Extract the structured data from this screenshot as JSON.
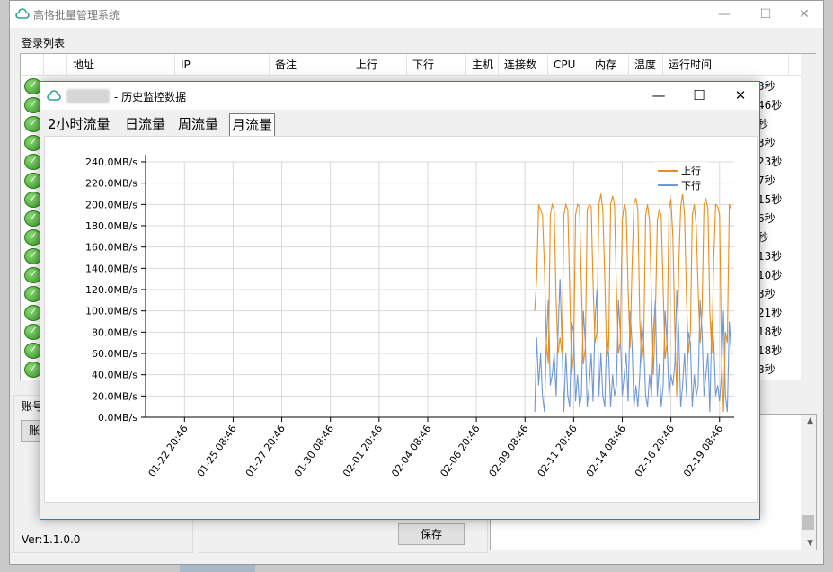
{
  "main_window": {
    "title": "高恪批量管理系统",
    "minimize": "—",
    "maximize": "☐",
    "close": "✕",
    "login_list_label": "登录列表",
    "columns": [
      "地址",
      "IP",
      "备注",
      "上行",
      "下行",
      "主机",
      "连接数",
      "CPU",
      "内存",
      "温度",
      "运行时间"
    ],
    "row_tails": [
      "3秒",
      "46秒",
      "秒",
      "3秒",
      "23秒",
      "7秒",
      "15秒",
      "6秒",
      "秒",
      "13秒",
      "10秒",
      "3秒",
      "21秒",
      "18秒",
      "18秒",
      "8秒"
    ],
    "account_label": "账号",
    "account_button": "账",
    "version": "Ver:1.1.0.0",
    "save_button": "保存"
  },
  "history_dialog": {
    "title": "- 历史监控数据",
    "minimize": "—",
    "maximize": "☐",
    "close": "✕",
    "tabs": [
      "2小时流量",
      "日流量",
      "周流量",
      "月流量"
    ],
    "active_tab": "月流量"
  },
  "colors": {
    "upload": "#e8901e",
    "download": "#6f98d4",
    "accent": "#1883d7",
    "status_ok": "#3a9a27"
  },
  "chart_data": {
    "type": "line",
    "title": "",
    "xlabel": "",
    "ylabel": "",
    "yticks": [
      "0.0MB/s",
      "20.0MB/s",
      "40.0MB/s",
      "60.0MB/s",
      "80.0MB/s",
      "100.0MB/s",
      "120.0MB/s",
      "140.0MB/s",
      "160.0MB/s",
      "180.0MB/s",
      "200.0MB/s",
      "220.0MB/s",
      "240.0MB/s"
    ],
    "ylim": [
      0,
      240
    ],
    "xticks": [
      "01-22 20:46",
      "01-25 08:46",
      "01-27 20:46",
      "01-30 08:46",
      "02-01 20:46",
      "02-04 08:46",
      "02-06 20:46",
      "02-09 08:46",
      "02-11 20:46",
      "02-14 08:46",
      "02-16 20:46",
      "02-19 08:46"
    ],
    "x_unit": "days after 01-20 20:46 (tick interval 2.5 days)",
    "xlim": [
      0,
      30.25
    ],
    "grid": true,
    "legend_position": "top-right",
    "series": [
      {
        "name": "上行",
        "color": "#e8901e",
        "x": [
          20.0,
          20.1,
          20.2,
          20.3,
          20.4,
          20.5,
          20.6,
          20.7,
          20.8,
          20.9,
          21.0,
          21.1,
          21.2,
          21.3,
          21.4,
          21.5,
          21.6,
          21.7,
          21.8,
          21.9,
          22.0,
          22.1,
          22.2,
          22.3,
          22.4,
          22.5,
          22.6,
          22.7,
          22.8,
          22.9,
          23.0,
          23.1,
          23.2,
          23.3,
          23.4,
          23.5,
          23.6,
          23.7,
          23.8,
          23.9,
          24.0,
          24.1,
          24.2,
          24.3,
          24.4,
          24.5,
          24.6,
          24.7,
          24.8,
          24.9,
          25.0,
          25.1,
          25.2,
          25.3,
          25.4,
          25.5,
          25.6,
          25.7,
          25.8,
          25.9,
          26.0,
          26.1,
          26.2,
          26.3,
          26.4,
          26.5,
          26.6,
          26.7,
          26.8,
          26.9,
          27.0,
          27.1,
          27.2,
          27.3,
          27.4,
          27.5,
          27.6,
          27.7,
          27.8,
          27.9,
          28.0,
          28.1,
          28.2,
          28.3,
          28.4,
          28.5,
          28.6,
          28.7,
          28.8,
          28.9,
          29.0,
          29.1,
          29.2,
          29.3,
          29.4,
          29.5,
          29.6,
          29.7,
          29.8,
          29.9,
          30.0,
          30.1
        ],
        "values": [
          100,
          130,
          200,
          195,
          190,
          140,
          70,
          50,
          190,
          200,
          195,
          110,
          60,
          75,
          60,
          190,
          200,
          195,
          120,
          40,
          60,
          190,
          200,
          198,
          125,
          50,
          65,
          195,
          200,
          198,
          125,
          70,
          80,
          200,
          210,
          195,
          130,
          55,
          65,
          200,
          208,
          200,
          120,
          60,
          70,
          185,
          200,
          195,
          120,
          65,
          140,
          200,
          206,
          195,
          90,
          50,
          70,
          190,
          200,
          185,
          110,
          40,
          95,
          185,
          195,
          190,
          120,
          55,
          70,
          195,
          205,
          170,
          80,
          20,
          140,
          198,
          210,
          190,
          110,
          60,
          80,
          190,
          200,
          180,
          120,
          70,
          100,
          200,
          205,
          196,
          100,
          60,
          150,
          200,
          198,
          190,
          60,
          5,
          80,
          70,
          200,
          195
        ]
      },
      {
        "name": "下行",
        "color": "#6f98d4",
        "x": [
          20.0,
          20.1,
          20.2,
          20.3,
          20.4,
          20.5,
          20.6,
          20.7,
          20.8,
          20.9,
          21.0,
          21.1,
          21.2,
          21.3,
          21.4,
          21.5,
          21.6,
          21.7,
          21.8,
          21.9,
          22.0,
          22.1,
          22.2,
          22.3,
          22.4,
          22.5,
          22.6,
          22.7,
          22.8,
          22.9,
          23.0,
          23.1,
          23.2,
          23.3,
          23.4,
          23.5,
          23.6,
          23.7,
          23.8,
          23.9,
          24.0,
          24.1,
          24.2,
          24.3,
          24.4,
          24.5,
          24.6,
          24.7,
          24.8,
          24.9,
          25.0,
          25.1,
          25.2,
          25.3,
          25.4,
          25.5,
          25.6,
          25.7,
          25.8,
          25.9,
          26.0,
          26.1,
          26.2,
          26.3,
          26.4,
          26.5,
          26.6,
          26.7,
          26.8,
          26.9,
          27.0,
          27.1,
          27.2,
          27.3,
          27.4,
          27.5,
          27.6,
          27.7,
          27.8,
          27.9,
          28.0,
          28.1,
          28.2,
          28.3,
          28.4,
          28.5,
          28.6,
          28.7,
          28.8,
          28.9,
          29.0,
          29.1,
          29.2,
          29.3,
          29.4,
          29.5,
          29.6,
          29.7,
          29.8,
          29.9,
          30.0,
          30.1
        ],
        "values": [
          5,
          75,
          30,
          60,
          20,
          5,
          70,
          110,
          30,
          40,
          60,
          20,
          80,
          130,
          70,
          5,
          60,
          20,
          10,
          90,
          80,
          15,
          40,
          10,
          20,
          100,
          70,
          10,
          30,
          60,
          15,
          90,
          120,
          20,
          60,
          20,
          10,
          80,
          60,
          10,
          40,
          20,
          30,
          110,
          80,
          20,
          40,
          60,
          15,
          100,
          70,
          10,
          30,
          10,
          40,
          90,
          70,
          20,
          10,
          40,
          20,
          80,
          110,
          20,
          50,
          10,
          30,
          100,
          70,
          20,
          40,
          30,
          50,
          120,
          80,
          10,
          30,
          60,
          20,
          80,
          70,
          10,
          40,
          20,
          30,
          110,
          80,
          20,
          40,
          60,
          5,
          90,
          70,
          20,
          30,
          15,
          40,
          100,
          20,
          5,
          90,
          60
        ]
      }
    ]
  }
}
